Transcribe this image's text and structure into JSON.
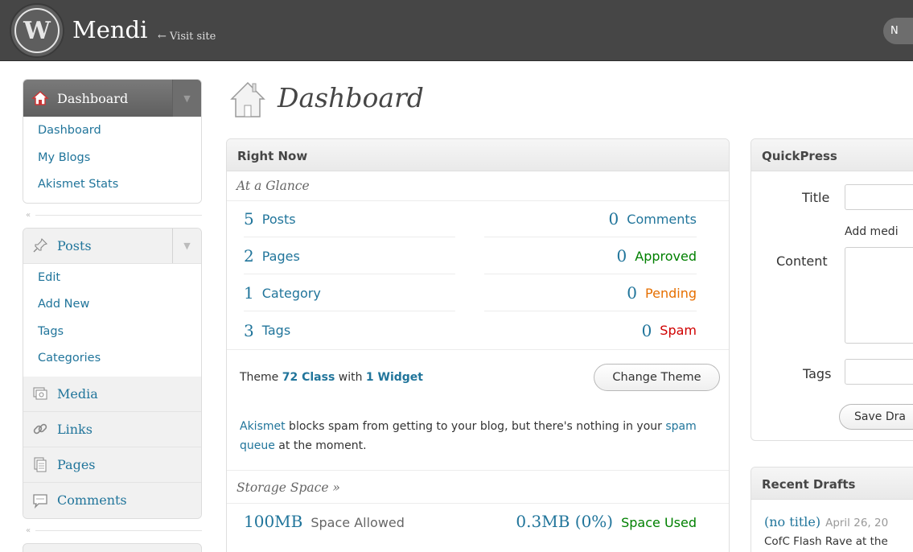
{
  "topbar": {
    "site_title": "Mendi",
    "visit_site": "← Visit site",
    "right_button": "N"
  },
  "sidebar": {
    "dashboard": {
      "label": "Dashboard",
      "items": [
        "Dashboard",
        "My Blogs",
        "Akismet Stats"
      ]
    },
    "posts": {
      "label": "Posts",
      "items": [
        "Edit",
        "Add New",
        "Tags",
        "Categories"
      ]
    },
    "media": "Media",
    "links": "Links",
    "pages": "Pages",
    "comments": "Comments"
  },
  "page": {
    "title": "Dashboard"
  },
  "right_now": {
    "title": "Right Now",
    "at_a_glance": "At a Glance",
    "content": [
      {
        "num": "5",
        "label": "Posts"
      },
      {
        "num": "2",
        "label": "Pages"
      },
      {
        "num": "1",
        "label": "Category"
      },
      {
        "num": "3",
        "label": "Tags"
      }
    ],
    "discussion": [
      {
        "num": "0",
        "label": "Comments"
      },
      {
        "num": "0",
        "label": "Approved"
      },
      {
        "num": "0",
        "label": "Pending"
      },
      {
        "num": "0",
        "label": "Spam"
      }
    ],
    "theme": {
      "prefix": "Theme",
      "name": "72 Class",
      "with": "with",
      "widgets": "1 Widget",
      "change_button": "Change Theme"
    },
    "akismet": {
      "link": "Akismet",
      "text1": " blocks spam from getting to your blog, but there's nothing in your ",
      "queue_link": "spam queue",
      "text2": " at the moment."
    },
    "storage": {
      "title": "Storage Space »",
      "allowed_num": "100MB",
      "allowed_label": "Space Allowed",
      "used_num": "0.3MB (0%)",
      "used_label": "Space Used"
    }
  },
  "quickpress": {
    "title": "QuickPress",
    "title_label": "Title",
    "add_media": "Add medi",
    "content_label": "Content",
    "tags_label": "Tags",
    "save_button": "Save Dra"
  },
  "recent_drafts": {
    "title": "Recent Drafts",
    "draft_title": "(no title)",
    "draft_date": "April 26, 20",
    "draft_excerpt": "CofC Flash Rave at the"
  }
}
